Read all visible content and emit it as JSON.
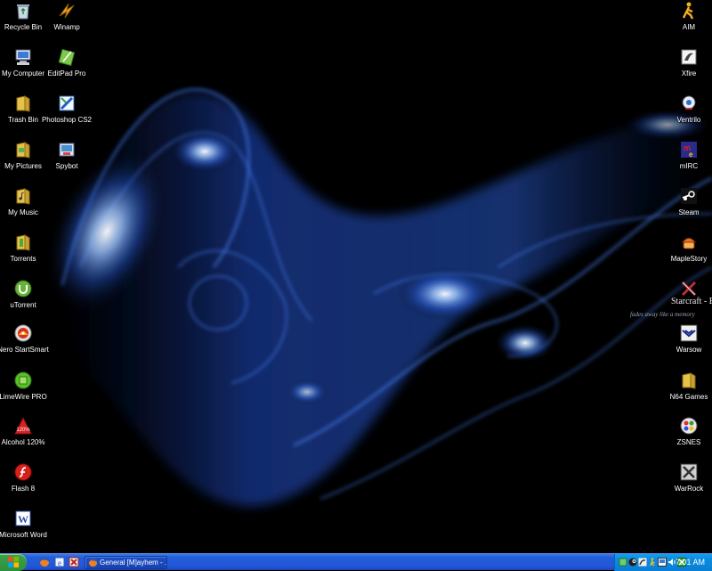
{
  "desktop": {
    "tagline": "fades away like a memory",
    "overlay_text": "Starcraft - Brood War",
    "icons_left_col1": [
      {
        "label": "Recycle Bin",
        "icon": "recycle-bin-icon"
      },
      {
        "label": "My Computer",
        "icon": "my-computer-icon"
      },
      {
        "label": "Trash Bin",
        "icon": "trash-bin-icon"
      },
      {
        "label": "My Pictures",
        "icon": "my-pictures-icon"
      },
      {
        "label": "My Music",
        "icon": "my-music-icon"
      },
      {
        "label": "Torrents",
        "icon": "torrents-folder-icon"
      },
      {
        "label": "uTorrent",
        "icon": "utorrent-icon"
      },
      {
        "label": "Nero StartSmart",
        "icon": "nero-icon"
      },
      {
        "label": "LimeWire PRO",
        "icon": "limewire-icon"
      },
      {
        "label": "Alcohol 120%",
        "icon": "alcohol-icon"
      },
      {
        "label": "Flash 8",
        "icon": "flash-icon"
      },
      {
        "label": "Microsoft Word",
        "icon": "word-icon"
      }
    ],
    "icons_left_col2": [
      {
        "label": "Winamp",
        "icon": "winamp-icon"
      },
      {
        "label": "EditPad Pro",
        "icon": "editpad-icon"
      },
      {
        "label": "Photoshop CS2",
        "icon": "photoshop-icon"
      },
      {
        "label": "Spybot",
        "icon": "spybot-icon"
      }
    ],
    "icons_right": [
      {
        "label": "AIM",
        "icon": "aim-icon"
      },
      {
        "label": "Xfire",
        "icon": "xfire-icon"
      },
      {
        "label": "Ventrilo",
        "icon": "ventrilo-icon"
      },
      {
        "label": "mIRC",
        "icon": "mirc-icon"
      },
      {
        "label": "Steam",
        "icon": "steam-icon"
      },
      {
        "label": "MapleStory",
        "icon": "maplestory-icon"
      },
      {
        "label": "",
        "icon": "starcraft-icon"
      },
      {
        "label": "Warsow",
        "icon": "warsow-icon"
      },
      {
        "label": "N64 Games",
        "icon": "n64-folder-icon"
      },
      {
        "label": "ZSNES",
        "icon": "zsnes-icon"
      },
      {
        "label": "WarRock",
        "icon": "warrock-icon"
      }
    ]
  },
  "taskbar": {
    "start_icon": "windows-orb-icon",
    "quick_launch": [
      "firefox-icon",
      "ie-icon",
      "media-icon"
    ],
    "task": {
      "label": "General [M]ayhem - ...",
      "icon": "firefox-icon"
    },
    "tray_icons": [
      "tray-app-icon",
      "tray-steam-icon",
      "tray-xfire-icon",
      "tray-aim-icon",
      "tray-network-icon",
      "tray-volume-icon",
      "tray-shield-icon"
    ],
    "clock": "7:01 AM"
  },
  "colors": {
    "taskbar": "#245edb",
    "start": "#2f8f3b",
    "tray": "#0b8ce0",
    "wallpaper_glow": "#3a7bff"
  }
}
